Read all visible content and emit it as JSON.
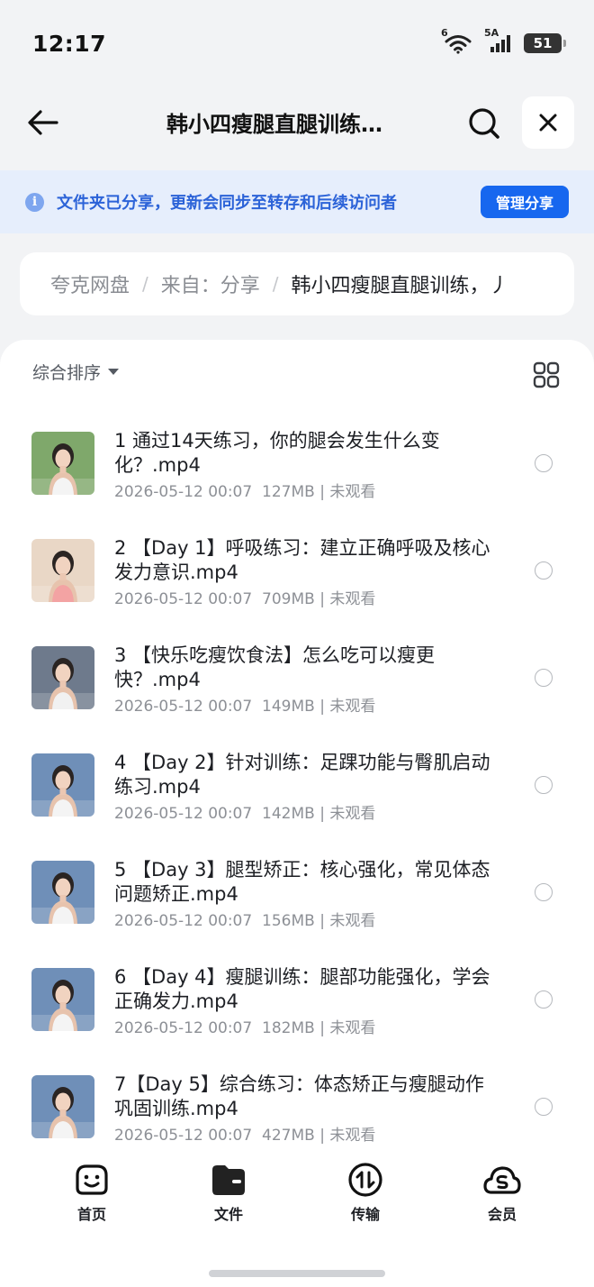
{
  "status_bar": {
    "time": "12:17",
    "wifi_label": "6",
    "cell_label": "5A",
    "battery": "51"
  },
  "nav": {
    "title": "韩小四瘦腿直腿训练…",
    "back_icon": "arrow-left-icon",
    "search_icon": "search-icon",
    "close_icon": "close-icon"
  },
  "share_banner": {
    "text": "文件夹已分享，更新会同步至转存和后续访问者",
    "button_label": "管理分享",
    "info_icon": "i"
  },
  "breadcrumb": {
    "items": [
      "夸克网盘",
      "来自：分享",
      "韩小四瘦腿直腿训练，丿"
    ]
  },
  "toolbar": {
    "sort_label": "综合排序",
    "grid_icon": "grid-view-icon"
  },
  "files": [
    {
      "name": "1 通过14天练习，你的腿会发生什么变化？.mp4",
      "date": "2026-05-12 00:07",
      "size": "127MB",
      "status": "未观看",
      "bg": "#7fa86b",
      "shirt": "#f4f4f4"
    },
    {
      "name": "2 【Day 1】呼吸练习：建立正确呼吸及核心发力意识.mp4",
      "date": "2026-05-12 00:07",
      "size": "709MB",
      "status": "未观看",
      "bg": "#e9d7c6",
      "shirt": "#f3a3a3"
    },
    {
      "name": "3 【快乐吃瘦饮食法】怎么吃可以瘦更快？.mp4",
      "date": "2026-05-12 00:07",
      "size": "149MB",
      "status": "未观看",
      "bg": "#6e7a8c",
      "shirt": "#f1f1f1"
    },
    {
      "name": "4 【Day 2】针对训练：足踝功能与臀肌启动练习.mp4",
      "date": "2026-05-12 00:07",
      "size": "142MB",
      "status": "未观看",
      "bg": "#6f8fb8",
      "shirt": "#f4f4f4"
    },
    {
      "name": "5 【Day 3】腿型矫正：核心强化，常见体态问题矫正.mp4",
      "date": "2026-05-12 00:07",
      "size": "156MB",
      "status": "未观看",
      "bg": "#6f8fb8",
      "shirt": "#f4f4f4"
    },
    {
      "name": "6 【Day 4】瘦腿训练：腿部功能强化，学会正确发力.mp4",
      "date": "2026-05-12 00:07",
      "size": "182MB",
      "status": "未观看",
      "bg": "#6f8fb8",
      "shirt": "#f4f4f4"
    },
    {
      "name": "7【Day 5】综合练习：体态矫正与瘦腿动作巩固训练.mp4",
      "date": "2026-05-12 00:07",
      "size": "427MB",
      "status": "未观看",
      "bg": "#6f8fb8",
      "shirt": "#f4f4f4"
    }
  ],
  "tabs": [
    {
      "label": "首页",
      "icon": "smiley-home-icon"
    },
    {
      "label": "文件",
      "icon": "folder-icon"
    },
    {
      "label": "传输",
      "icon": "transfer-icon"
    },
    {
      "label": "会员",
      "icon": "member-cloud-icon"
    }
  ],
  "colors": {
    "accent": "#1767ef",
    "banner_bg": "#e6eefc",
    "banner_text": "#2c63d8",
    "page_bg": "#f2f3f5"
  }
}
